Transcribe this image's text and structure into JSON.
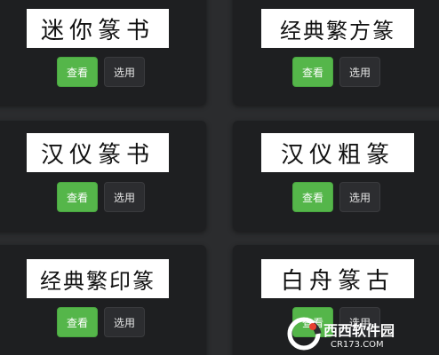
{
  "buttons": {
    "view_label": "查看",
    "select_label": "选用"
  },
  "fonts": [
    {
      "sample": "迷你篆书",
      "style": "迷你篆书"
    },
    {
      "sample": "经典繁方篆",
      "style": "经典繁方篆"
    },
    {
      "sample": "汉仪篆书",
      "style": "汉仪篆书"
    },
    {
      "sample": "汉仪粗篆",
      "style": "汉仪粗篆"
    },
    {
      "sample": "经典繁印篆",
      "style": "经典繁印篆"
    },
    {
      "sample": "白舟篆古",
      "style": "白舟篆古"
    }
  ],
  "watermark": {
    "brand": "西西软件园",
    "url": "CR173.COM"
  },
  "colors": {
    "view_button": "#55b64a",
    "select_button": "#2c2d30",
    "card_bg": "#1e1f21",
    "page_bg": "#2b2c2e"
  }
}
